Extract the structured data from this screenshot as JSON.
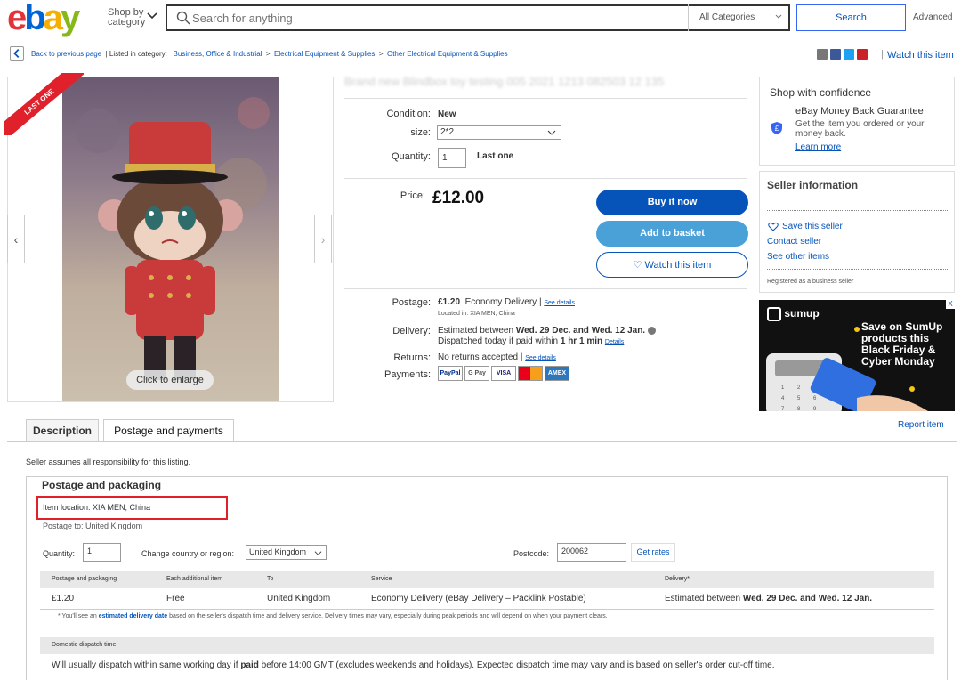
{
  "header": {
    "logo": [
      "e",
      "b",
      "a",
      "y"
    ],
    "shop_by_line1": "Shop by",
    "shop_by_line2": "category",
    "search_placeholder": "Search for anything",
    "category": "All Categories",
    "search_button": "Search",
    "advanced": "Advanced"
  },
  "breadcrumb": {
    "back": "Back to previous page",
    "listed_in": "| Listed in category:",
    "items": [
      "Business, Office & Industrial",
      "Electrical Equipment & Supplies",
      "Other Electrical Equipment & Supplies"
    ],
    "sep": ">",
    "watch": "Watch this item",
    "divider": "|"
  },
  "gallery": {
    "badge": "LAST ONE",
    "prev": "‹",
    "next": "›",
    "enlarge": "Click to enlarge"
  },
  "item": {
    "title": "Brand new Blindbox toy testing 005 2021 1213 082503 12 135",
    "condition_label": "Condition:",
    "condition_value": "New",
    "size_label": "size:",
    "size_value": "2*2",
    "quantity_label": "Quantity:",
    "quantity_value": "1",
    "quantity_note": "Last one",
    "price_label": "Price:",
    "price": "£12.00",
    "buy_now": "Buy it now",
    "add_basket": "Add to basket",
    "watch": "♡ Watch this item",
    "postage_label": "Postage:",
    "postage_amount": "£1.20",
    "postage_service": "Economy Delivery |",
    "see_details": "See details",
    "located_in": "Located in: XIA MEN, China",
    "delivery_label": "Delivery:",
    "delivery_line1_pre": "Estimated between",
    "delivery_line1_bold": "Wed. 29 Dec. and Wed. 12 Jan.",
    "delivery_line2_pre": "Dispatched today if paid within",
    "delivery_line2_bold": "1 hr 1 min",
    "delivery_details": "Details",
    "returns_label": "Returns:",
    "returns_value": "No returns accepted |",
    "returns_details": "See details",
    "payments_label": "Payments:",
    "payment_methods": [
      "PayPal",
      "G Pay",
      "VISA",
      "MC",
      "AMEX"
    ]
  },
  "sidebar": {
    "confidence_title": "Shop with confidence",
    "guarantee_title": "eBay Money Back Guarantee",
    "guarantee_text": "Get the item you ordered or your money back.",
    "learn_more": "Learn more",
    "seller_title": "Seller information",
    "save_seller": "Save this seller",
    "contact_seller": "Contact seller",
    "other_items": "See other items",
    "registered": "Registered as a business seller",
    "ad_logo": "sumup",
    "ad_text": "Save on SumUp products this Black Friday & Cyber Monday",
    "ad_close": "X"
  },
  "tabs": {
    "description": "Description",
    "postage": "Postage and payments",
    "report": "Report item"
  },
  "postage_section": {
    "assume": "Seller assumes all responsibility for this listing.",
    "heading": "Postage and packaging",
    "item_location": "Item location: XIA MEN, China",
    "postage_to": "Postage to: United Kingdom",
    "quantity_label": "Quantity:",
    "quantity_value": "1",
    "country_label": "Change country or region:",
    "country_value": "United Kingdom",
    "postcode_label": "Postcode:",
    "postcode_value": "200062",
    "get_rates": "Get rates",
    "columns": [
      "Postage and packaging",
      "Each additional item",
      "To",
      "Service",
      "Delivery*"
    ],
    "row": {
      "cost": "£1.20",
      "additional": "Free",
      "to": "United Kingdom",
      "service": "Economy Delivery (eBay Delivery – Packlink Postable)",
      "delivery_pre": "Estimated between",
      "delivery_bold": "Wed. 29 Dec. and Wed. 12 Jan."
    },
    "footnote_pre": "* You'll see an",
    "footnote_link": "estimated delivery date",
    "footnote_post": "based on the seller's dispatch time and delivery service. Delivery times may vary, especially during peak periods and will depend on when your payment clears.",
    "domestic_heading": "Domestic dispatch time",
    "domestic_pre": "Will usually dispatch within same working day if",
    "domestic_bold": "paid",
    "domestic_post": "before 14:00 GMT (excludes weekends and holidays). Expected dispatch time may vary and is based on seller's order cut-off time."
  }
}
